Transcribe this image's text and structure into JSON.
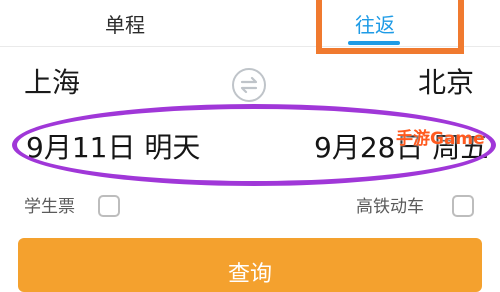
{
  "tabs": [
    {
      "label": "单程",
      "selected": false
    },
    {
      "label": "往返",
      "selected": true
    }
  ],
  "route": {
    "from_city": "上海",
    "to_city": "北京",
    "swap_icon": "swap-arrows-icon"
  },
  "dates": {
    "depart": "9月11日 明天",
    "return": "9月28日 周五"
  },
  "options": {
    "student_label": "学生票",
    "student_checked": false,
    "highspeed_label": "高铁动车",
    "highspeed_checked": false
  },
  "search_button": "查询",
  "watermark": "手游Game",
  "colors": {
    "accent_blue": "#1e9be6",
    "button_orange": "#f4a12e",
    "annotation_orange": "#f07a2f",
    "annotation_purple": "#a037d8"
  }
}
